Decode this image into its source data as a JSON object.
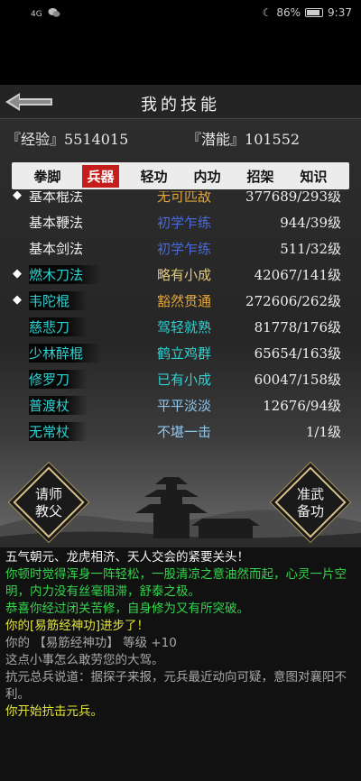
{
  "status": {
    "signal": "4G",
    "battery_pct": "86%",
    "time": "9:37"
  },
  "header": {
    "title": "我的技能"
  },
  "stats": {
    "exp_label": "『经验』",
    "exp_value": "5514015",
    "pot_label": "『潜能』",
    "pot_value": "101552"
  },
  "tabs": [
    {
      "label": "拳脚",
      "active": false
    },
    {
      "label": "兵器",
      "active": true
    },
    {
      "label": "轻功",
      "active": false
    },
    {
      "label": "内功",
      "active": false
    },
    {
      "label": "招架",
      "active": false
    },
    {
      "label": "知识",
      "active": false
    }
  ],
  "skills": [
    {
      "mark": "◆",
      "name": "基本棍法",
      "level": "无可匹敌",
      "num": "377689/293级"
    },
    {
      "mark": "",
      "name": "基本鞭法",
      "level": "初学乍练",
      "num": "944/39级"
    },
    {
      "mark": "",
      "name": "基本剑法",
      "level": "初学乍练",
      "num": "511/32级"
    },
    {
      "mark": "◆",
      "name": "燃木刀法",
      "level": "略有小成",
      "num": "42067/141级"
    },
    {
      "mark": "◆",
      "name": "韦陀棍",
      "level": "豁然贯通",
      "num": "272606/262级"
    },
    {
      "mark": "",
      "name": "慈悲刀",
      "level": "驾轻就熟",
      "num": "81778/176级"
    },
    {
      "mark": "",
      "name": "少林醉棍",
      "level": "鹤立鸡群",
      "num": "65654/163级"
    },
    {
      "mark": "",
      "name": "修罗刀",
      "level": "已有小成",
      "num": "60047/158级"
    },
    {
      "mark": "",
      "name": "普渡杖",
      "level": "平平淡淡",
      "num": "12676/94级"
    },
    {
      "mark": "",
      "name": "无常杖",
      "level": "不堪一击",
      "num": "1/1级"
    }
  ],
  "buttons": {
    "left_label": "请师\n教父",
    "right_label": "准武\n备功"
  },
  "log": [
    {
      "text": "五气朝元、龙虎相济、天人交会的紧要关头！",
      "color": "white"
    },
    {
      "text": "你顿时觉得浑身一阵轻松，一股清凉之意油然而起，心灵一片空明，内力没有丝毫阻滞，舒泰之极。",
      "color": "green"
    },
    {
      "text": "恭喜你经过闭关苦修，自身修为又有所突破。",
      "color": "green"
    },
    {
      "text": "你的[易筋经神功]进步了！",
      "color": "yellow"
    },
    {
      "text": "你的 【易筋经神功】 等级 +10",
      "color": "gray"
    },
    {
      "text": "这点小事怎么敢劳您的大驾。",
      "color": "gray"
    },
    {
      "text": "抗元总兵说道：据探子来报，元兵最近动向可疑，意图对襄阳不利。",
      "color": "gray"
    },
    {
      "text": "你开始抗击元兵。",
      "color": "yellow"
    }
  ]
}
